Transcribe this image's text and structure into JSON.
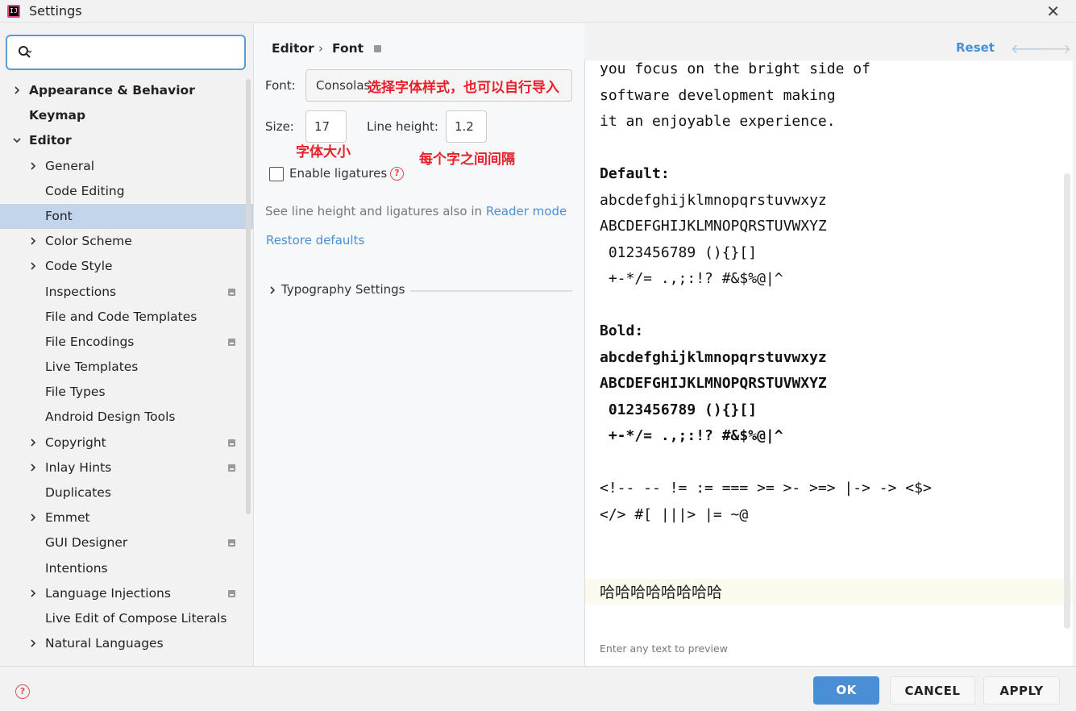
{
  "window": {
    "title": "Settings",
    "app_icon_text": "IJ"
  },
  "search": {
    "placeholder": "",
    "value": ""
  },
  "sidebar": {
    "items": [
      {
        "label": "Appearance & Behavior",
        "bold": true,
        "chevron": "right",
        "indent": 0,
        "project": false,
        "selected": false
      },
      {
        "label": "Keymap",
        "bold": true,
        "chevron": "none",
        "indent": 0,
        "project": false,
        "selected": false
      },
      {
        "label": "Editor",
        "bold": true,
        "chevron": "down",
        "indent": 0,
        "project": false,
        "selected": false
      },
      {
        "label": "General",
        "bold": false,
        "chevron": "right",
        "indent": 1,
        "project": false,
        "selected": false
      },
      {
        "label": "Code Editing",
        "bold": false,
        "chevron": "none",
        "indent": 1,
        "project": false,
        "selected": false
      },
      {
        "label": "Font",
        "bold": false,
        "chevron": "none",
        "indent": 1,
        "project": false,
        "selected": true
      },
      {
        "label": "Color Scheme",
        "bold": false,
        "chevron": "right",
        "indent": 1,
        "project": false,
        "selected": false
      },
      {
        "label": "Code Style",
        "bold": false,
        "chevron": "right",
        "indent": 1,
        "project": false,
        "selected": false
      },
      {
        "label": "Inspections",
        "bold": false,
        "chevron": "none",
        "indent": 1,
        "project": true,
        "selected": false
      },
      {
        "label": "File and Code Templates",
        "bold": false,
        "chevron": "none",
        "indent": 1,
        "project": false,
        "selected": false
      },
      {
        "label": "File Encodings",
        "bold": false,
        "chevron": "none",
        "indent": 1,
        "project": true,
        "selected": false
      },
      {
        "label": "Live Templates",
        "bold": false,
        "chevron": "none",
        "indent": 1,
        "project": false,
        "selected": false
      },
      {
        "label": "File Types",
        "bold": false,
        "chevron": "none",
        "indent": 1,
        "project": false,
        "selected": false
      },
      {
        "label": "Android Design Tools",
        "bold": false,
        "chevron": "none",
        "indent": 1,
        "project": false,
        "selected": false
      },
      {
        "label": "Copyright",
        "bold": false,
        "chevron": "right",
        "indent": 1,
        "project": true,
        "selected": false
      },
      {
        "label": "Inlay Hints",
        "bold": false,
        "chevron": "right",
        "indent": 1,
        "project": true,
        "selected": false
      },
      {
        "label": "Duplicates",
        "bold": false,
        "chevron": "none",
        "indent": 1,
        "project": false,
        "selected": false
      },
      {
        "label": "Emmet",
        "bold": false,
        "chevron": "right",
        "indent": 1,
        "project": false,
        "selected": false
      },
      {
        "label": "GUI Designer",
        "bold": false,
        "chevron": "none",
        "indent": 1,
        "project": true,
        "selected": false
      },
      {
        "label": "Intentions",
        "bold": false,
        "chevron": "none",
        "indent": 1,
        "project": false,
        "selected": false
      },
      {
        "label": "Language Injections",
        "bold": false,
        "chevron": "right",
        "indent": 1,
        "project": true,
        "selected": false
      },
      {
        "label": "Live Edit of Compose Literals",
        "bold": false,
        "chevron": "none",
        "indent": 1,
        "project": false,
        "selected": false
      },
      {
        "label": "Natural Languages",
        "bold": false,
        "chevron": "right",
        "indent": 1,
        "project": false,
        "selected": false
      }
    ]
  },
  "breadcrumb": {
    "parent": "Editor",
    "separator": "›",
    "current": "Font"
  },
  "header": {
    "reset": "Reset",
    "back": "🡐",
    "forward": "🡒"
  },
  "font_settings": {
    "font_label": "Font:",
    "font_value": "Consolas",
    "size_label": "Size:",
    "size_value": "17",
    "line_height_label": "Line height:",
    "line_height_value": "1.2",
    "ligatures_label": "Enable ligatures",
    "ligatures_checked": false,
    "hint_prefix": "See line height and ligatures also in",
    "hint_link": "Reader mode",
    "restore_defaults": "Restore defaults",
    "typography": "Typography Settings"
  },
  "annotations": {
    "font_style": "选择字体样式，也可以自行导入",
    "font_size": "字体大小",
    "line_spacing": "每个字之间间隔"
  },
  "preview": {
    "lines": [
      {
        "text": "you focus on the bright side of",
        "bold": false
      },
      {
        "text": "software development making",
        "bold": false
      },
      {
        "text": "it an enjoyable experience.",
        "bold": false
      },
      {
        "text": "",
        "bold": false
      },
      {
        "text": "Default:",
        "bold": true
      },
      {
        "text": "abcdefghijklmnopqrstuvwxyz",
        "bold": false
      },
      {
        "text": "ABCDEFGHIJKLMNOPQRSTUVWXYZ",
        "bold": false
      },
      {
        "text": " 0123456789 (){}[]",
        "bold": false
      },
      {
        "text": " +-*/= .,;:!? #&$%@|^",
        "bold": false
      },
      {
        "text": "",
        "bold": false
      },
      {
        "text": "Bold:",
        "bold": true
      },
      {
        "text": "abcdefghijklmnopqrstuvwxyz",
        "bold": true
      },
      {
        "text": "ABCDEFGHIJKLMNOPQRSTUVWXYZ",
        "bold": true
      },
      {
        "text": " 0123456789 (){}[]",
        "bold": true
      },
      {
        "text": " +-*/= .,;:!? #&$%@|^",
        "bold": true
      },
      {
        "text": "",
        "bold": false
      },
      {
        "text": "<!-- -- != := === >= >- >=> |-> -> <$>",
        "bold": false
      },
      {
        "text": "</> #[ |||> |= ~@",
        "bold": false
      }
    ],
    "custom_text": "哈哈哈哈哈哈哈哈",
    "hint": "Enter any text to preview"
  },
  "buttons": {
    "ok": "OK",
    "cancel": "CANCEL",
    "apply": "APPLY"
  },
  "colors": {
    "accent": "#4a8fd6",
    "selected": "#c2d5ea",
    "annotation": "#e8202a"
  }
}
